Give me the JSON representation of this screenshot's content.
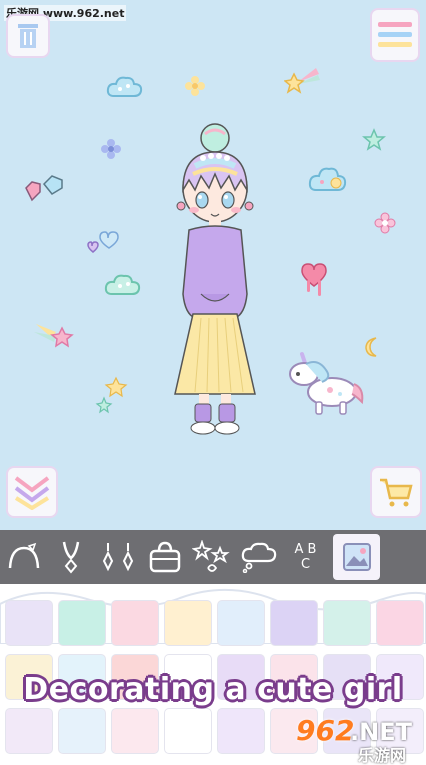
{
  "watermark": "乐游网 www.962.net",
  "caption": "Decorating a cute girl",
  "logo": {
    "number": "962",
    "suffix": ".NET",
    "chinese": "乐游网"
  },
  "toolbar": {
    "items": [
      "headband-icon",
      "necklace-icon",
      "earrings-icon",
      "bag-icon",
      "sparkles-icon",
      "speech-bubble-icon",
      "abc-letters-icon",
      "background-icon"
    ],
    "active": "background-icon",
    "letters_text": "A B C"
  },
  "palette": {
    "rows": [
      [
        "#e9e3f7",
        "#c8f0e6",
        "#fbd9e2",
        "#fff0d0",
        "#e1eefb",
        "#dcd3f5",
        "#d4f1ea",
        "#fbd6e4"
      ],
      [
        "#fbf2d6",
        "#e3f3fb",
        "#fbd7d7",
        "#ffffff",
        "#e8dcf7",
        "#fbe3ea",
        "#e6e0f6",
        "#f0e9fb"
      ],
      [
        "#f2e9f8",
        "#e6f2fb",
        "#fce8ee",
        "#ffffff",
        "#efe6fa",
        "#fbe9ef",
        "#eae5f8",
        "#f3eefb"
      ]
    ]
  },
  "colors": {
    "stage_bg": "#cde6f4",
    "toolbar_bg": "#6e6e72",
    "caption_outline": "#7a3d8c"
  }
}
